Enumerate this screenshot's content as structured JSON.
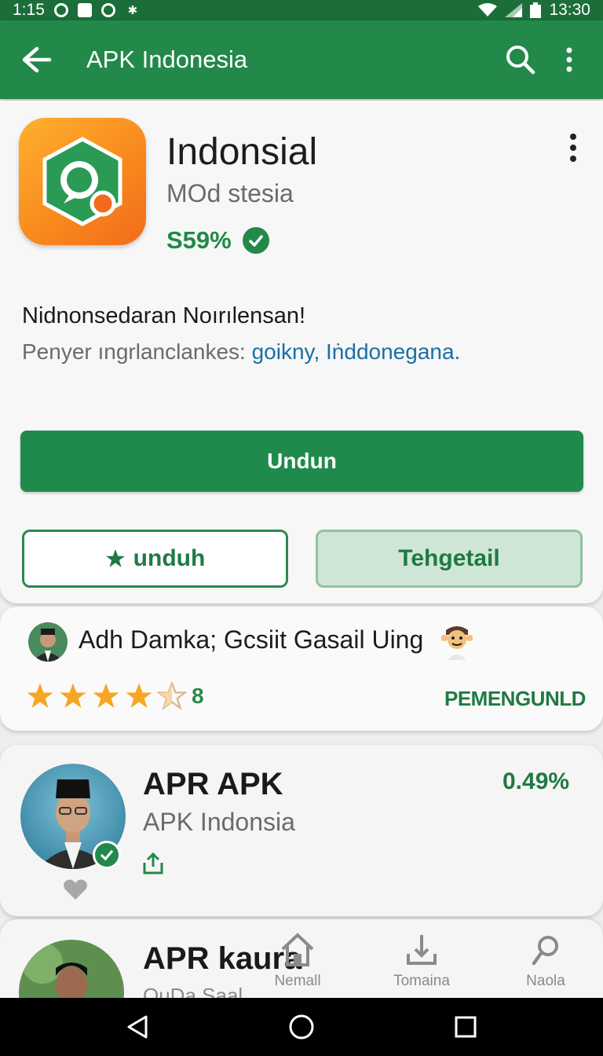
{
  "status_bar": {
    "time_left": "1:15",
    "time_right": "13:30"
  },
  "app_bar": {
    "title": "APK Indonesia"
  },
  "app": {
    "name": "Indonsial",
    "developer": "MOd stesia",
    "rating": "S59%",
    "desc_title": "Nidnonsedaran Noırılensan!",
    "desc_prefix": "Penyer ıngrlanclankes: ",
    "desc_link": "goikny, Iṅddonegana.",
    "primary_button": "Undun",
    "secondary_button": "unduh",
    "tonal_button": "Tehgetail",
    "accent": "#22894a",
    "icon_bg": "#f8871d"
  },
  "review": {
    "text": "Adh Damka; Gcsiit Gasail Uing",
    "rating_count": "8",
    "stars_filled": 4,
    "action": "PEMENGUNLD"
  },
  "list_items": [
    {
      "title": "APR APK",
      "subtitle": "APK Indonsia",
      "percent": "0.49%"
    },
    {
      "title": "APR kaura",
      "subtitle": "OuDa Saal"
    }
  ],
  "bottom_tabs": [
    {
      "label": "Nemall",
      "icon": "home-icon"
    },
    {
      "label": "Tomaina",
      "icon": "download-icon"
    },
    {
      "label": "Naola",
      "icon": "search-icon"
    }
  ],
  "nav": {
    "back": "back-icon",
    "home": "home-circle-icon",
    "recents": "recents-icon"
  }
}
